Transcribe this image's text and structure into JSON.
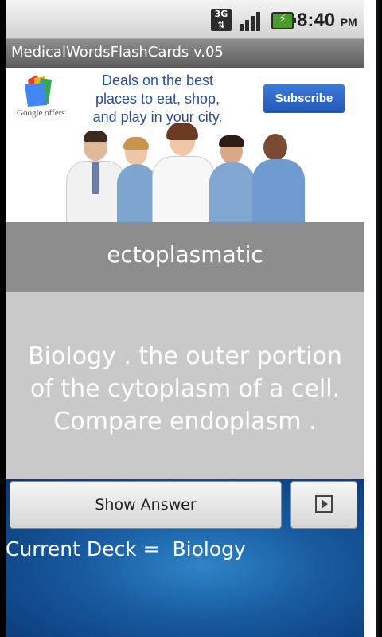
{
  "status_bar": {
    "network": "3G",
    "time": "8:40",
    "ampm": "PM"
  },
  "title_bar": {
    "title": "MedicalWordsFlashCards v.05"
  },
  "ad": {
    "logo_text": "Google offers",
    "headline": "Deals on the best places to eat, shop, and play in your city.",
    "button_label": "Subscribe"
  },
  "card": {
    "word": "ectoplasmatic",
    "definition": "Biology .  the outer portion of the cytoplasm of a cell. Compare  endoplasm ."
  },
  "controls": {
    "show_answer_label": "Show Answer",
    "deck_text": "Current Deck =  Biology"
  },
  "colors": {
    "word_band": "#8d8d8d",
    "definition_band": "#c9c9c9",
    "bottom_background": "#17599f"
  }
}
